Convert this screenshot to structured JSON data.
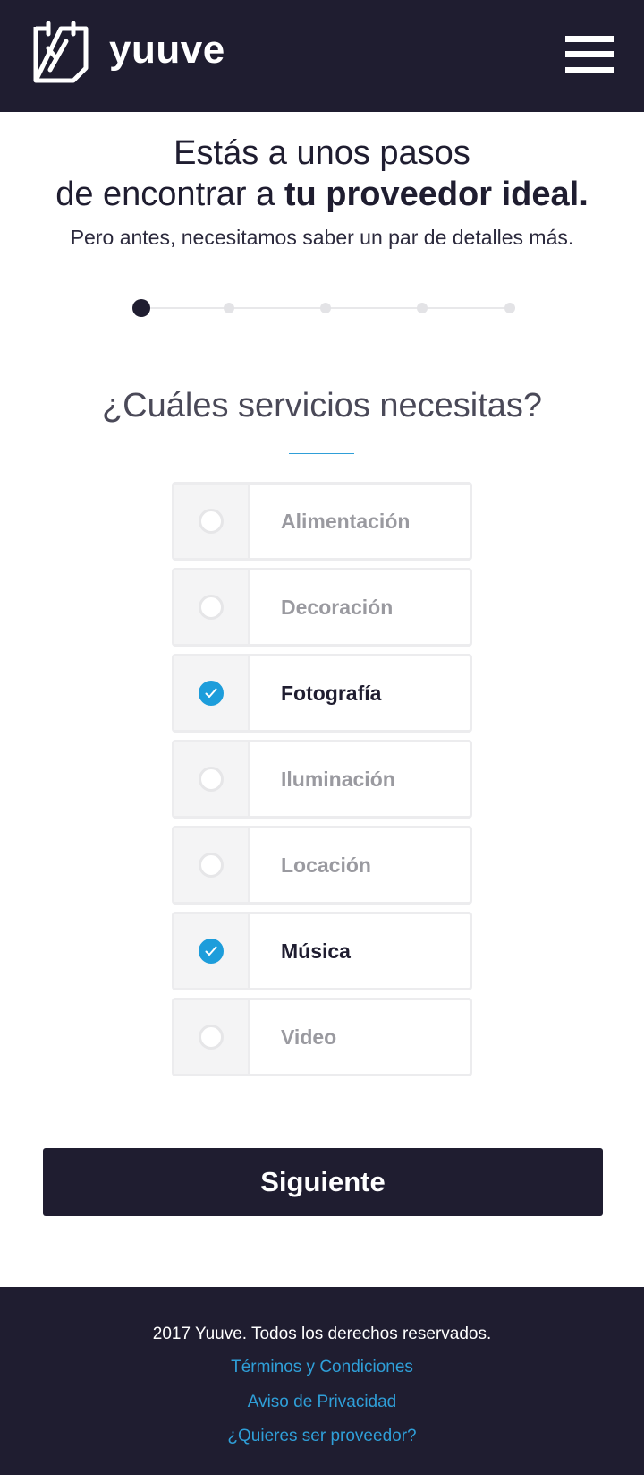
{
  "header": {
    "brand": "yuuve",
    "logo_icon": "calendar-check-icon",
    "menu_icon": "hamburger-menu-icon"
  },
  "hero": {
    "line1": "Estás a unos pasos",
    "line2_prefix": "de encontrar a ",
    "line2_bold": "tu proveedor ideal.",
    "subtitle": "Pero antes, necesitamos saber un par de detalles más."
  },
  "stepper": {
    "total_steps": 5,
    "current_step": 1
  },
  "question": {
    "title": "¿Cuáles servicios necesitas?"
  },
  "options": [
    {
      "label": "Alimentación",
      "checked": false
    },
    {
      "label": "Decoración",
      "checked": false
    },
    {
      "label": "Fotografía",
      "checked": true
    },
    {
      "label": "Iluminación",
      "checked": false
    },
    {
      "label": "Locación",
      "checked": false
    },
    {
      "label": "Música",
      "checked": true
    },
    {
      "label": "Video",
      "checked": false
    }
  ],
  "actions": {
    "next_label": "Siguiente"
  },
  "footer": {
    "copyright": "2017 Yuuve.  Todos los derechos reservados.",
    "terms": "Términos y Condiciones",
    "privacy": "Aviso de Privacidad",
    "provider": "¿Quieres ser proveedor?"
  },
  "colors": {
    "dark": "#1f1d30",
    "accent": "#1d9ddb",
    "link": "#2f9fd8"
  }
}
